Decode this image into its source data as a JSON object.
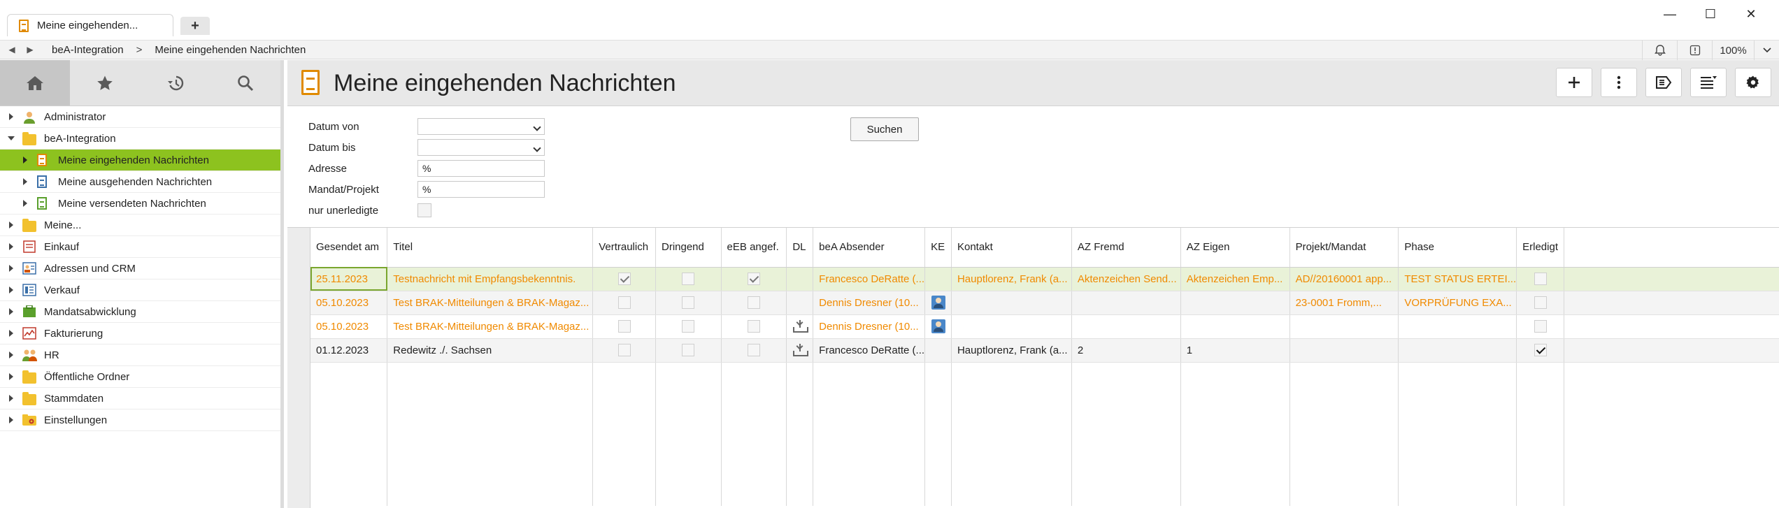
{
  "window": {
    "tab_title": "Meine eingehenden...",
    "new_tab": "+",
    "minimize": "—",
    "maximize": "☐",
    "close": "✕"
  },
  "addressbar": {
    "crumbs": [
      "beA-Integration",
      "Meine eingehenden Nachrichten"
    ],
    "separator": ">",
    "zoom": "100%"
  },
  "sidebar": {
    "tabs": [
      "home-icon",
      "star-icon",
      "history-icon",
      "search-icon"
    ],
    "items": [
      {
        "label": "Administrator",
        "icon": "user-icon",
        "level": 0,
        "expanded": false
      },
      {
        "label": "beA-Integration",
        "icon": "folder-icon",
        "level": 0,
        "expanded": true
      },
      {
        "label": "Meine eingehenden Nachrichten",
        "icon": "document-icon",
        "level": 1,
        "selected": true
      },
      {
        "label": "Meine ausgehenden Nachrichten",
        "icon": "document-icon",
        "level": 1
      },
      {
        "label": "Meine versendeten Nachrichten",
        "icon": "document-icon",
        "level": 1
      },
      {
        "label": "Meine...",
        "icon": "folder-icon",
        "level": 0
      },
      {
        "label": "Einkauf",
        "icon": "purchase-icon",
        "level": 0
      },
      {
        "label": "Adressen und CRM",
        "icon": "contacts-icon",
        "level": 0
      },
      {
        "label": "Verkauf",
        "icon": "sales-icon",
        "level": 0
      },
      {
        "label": "Mandatsabwicklung",
        "icon": "cases-icon",
        "level": 0
      },
      {
        "label": "Fakturierung",
        "icon": "invoice-icon",
        "level": 0
      },
      {
        "label": "HR",
        "icon": "hr-icon",
        "level": 0
      },
      {
        "label": "Öffentliche Ordner",
        "icon": "folder-icon",
        "level": 0
      },
      {
        "label": "Stammdaten",
        "icon": "folder-icon",
        "level": 0
      },
      {
        "label": "Einstellungen",
        "icon": "settings-folder-icon",
        "level": 0
      }
    ]
  },
  "main": {
    "title": "Meine eingehenden Nachrichten",
    "toolbar": [
      "plus-icon",
      "more-vertical-icon",
      "forward-icon",
      "sort-list-icon",
      "gear-icon"
    ]
  },
  "filter": {
    "datum_von_label": "Datum von",
    "datum_bis_label": "Datum bis",
    "adresse_label": "Adresse",
    "adresse_value": "%",
    "mandat_label": "Mandat/Projekt",
    "mandat_value": "%",
    "unerledigt_label": "nur unerledigte",
    "search_label": "Suchen"
  },
  "table": {
    "columns": [
      "Gesendet am",
      "Titel",
      "Vertraulich",
      "Dringend",
      "eEB angef.",
      "DL",
      "beA Absender",
      "KE",
      "Kontakt",
      "AZ Fremd",
      "AZ Eigen",
      "Projekt/Mandat",
      "Phase",
      "Erledigt"
    ],
    "rows": [
      {
        "date": "25.11.2023",
        "title": "Testnachricht mit Empfangsbekenntnis.",
        "vertraulich": true,
        "dringend": false,
        "eeb": true,
        "dl": false,
        "sender": "Francesco DeRatte (...",
        "ke": false,
        "kontakt": "Hauptlorenz, Frank (a...",
        "az_fremd": "Aktenzeichen Send...",
        "az_eigen": "Aktenzeichen Emp...",
        "projekt": "AD//20160001 app...",
        "phase": "TEST STATUS ERTEI...",
        "erledigt": false
      },
      {
        "date": "05.10.2023",
        "title": "Test BRAK-Mitteilungen & BRAK-Magaz...",
        "vertraulich": false,
        "dringend": false,
        "eeb": false,
        "dl": false,
        "sender": "Dennis Dresner (10...",
        "ke": true,
        "kontakt": "",
        "az_fremd": "",
        "az_eigen": "",
        "projekt": "23-0001 Fromm,...",
        "phase": "VORPRÜFUNG EXA...",
        "erledigt": false
      },
      {
        "date": "05.10.2023",
        "title": "Test BRAK-Mitteilungen & BRAK-Magaz...",
        "vertraulich": false,
        "dringend": false,
        "eeb": false,
        "dl": true,
        "sender": "Dennis Dresner (10...",
        "ke": true,
        "kontakt": "",
        "az_fremd": "",
        "az_eigen": "",
        "projekt": "",
        "phase": "",
        "erledigt": false
      },
      {
        "date": "01.12.2023",
        "title": "Redewitz ./. Sachsen",
        "vertraulich": false,
        "dringend": false,
        "eeb": false,
        "dl": true,
        "sender": "Francesco DeRatte (...",
        "ke": false,
        "kontakt": "Hauptlorenz, Frank (a...",
        "az_fremd": "2",
        "az_eigen": "1",
        "projekt": "",
        "phase": "",
        "erledigt": true
      }
    ]
  },
  "colors": {
    "accent_green": "#8dc21f",
    "orange_text": "#f08a00"
  }
}
